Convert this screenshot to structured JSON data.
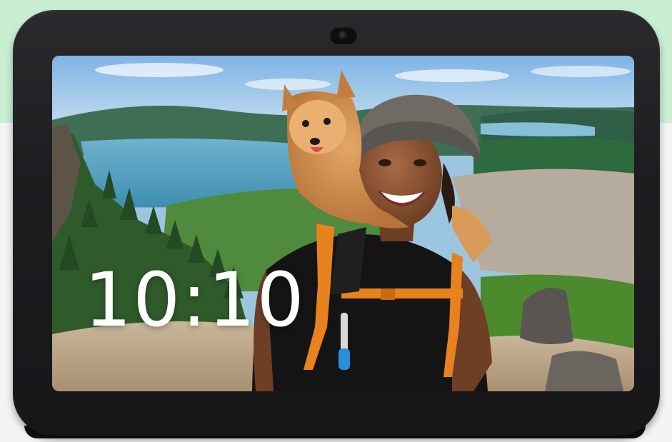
{
  "screen": {
    "clock_time": "10:10"
  },
  "icons": {
    "camera": "camera-icon",
    "photo": "photo-background"
  },
  "colors": {
    "background_accent": "#c9efd3",
    "device_frame": "#1d1d20",
    "clock_text": "#ffffff"
  }
}
